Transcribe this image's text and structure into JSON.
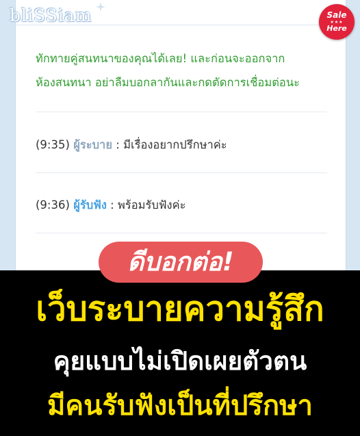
{
  "brand": {
    "logo_text": "bliSSiam"
  },
  "badge": {
    "line1": "Sale",
    "line2": "Here"
  },
  "chat": {
    "notice_lines": [
      "ทักทายคู่สนทนาของคุณได้เลย! และก่อนจะออกจาก",
      "ห้องสนทนา อย่าลืมบอกลากันและกดตัดการเชื่อมต่อนะ"
    ],
    "messages": [
      {
        "time": "(9:35)",
        "sender": "ผู้ระบาย",
        "separator": " : ",
        "text": "มีเรื่องอยากปรึกษาค่ะ"
      },
      {
        "time": "(9:36)",
        "sender": "ผู้รับฟัง",
        "separator": " : ",
        "text": "พร้อมรับฟังค่ะ"
      }
    ]
  },
  "banner": {
    "pill": "ดีบอกต่อ!",
    "headline": "เว็บระบายความรู้สึก",
    "line2": "คุยแบบไม่เปิดเผยตัวตน",
    "line3": "มีคนรับฟังเป็นที่ปรึกษา"
  },
  "colors": {
    "notice": "#2f9d2f",
    "sender_a": "#8fa7bd",
    "sender_b": "#4aa3e3",
    "pill": "#e8585a",
    "highlight": "#ffe200",
    "badge": "#e2223b"
  }
}
